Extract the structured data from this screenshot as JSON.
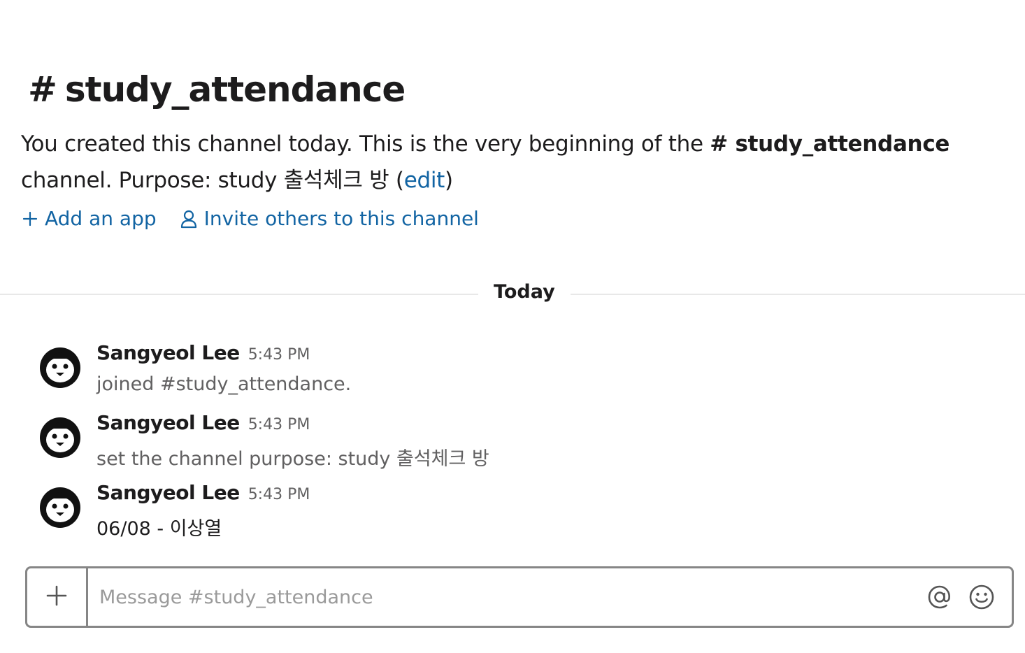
{
  "channel": {
    "hash": "#",
    "name": "study_attendance"
  },
  "intro": {
    "text_before": "You created this channel today. This is the very beginning of the ",
    "channel_ref": "# study_attendance",
    "text_after": " channel. Purpose: study 출석체크 방 (",
    "edit_link": "edit",
    "close_paren": ")"
  },
  "actions": {
    "add_app": "Add an app",
    "invite": "Invite others to this channel"
  },
  "divider": {
    "label": "Today"
  },
  "messages": [
    {
      "sender": "Sangyeol Lee",
      "time": "5:43 PM",
      "text": "joined #study_attendance.",
      "system": true,
      "avatar": "penguin-icon"
    },
    {
      "sender": "Sangyeol Lee",
      "time": "5:43 PM",
      "text": "set the channel purpose: study 출석체크 방",
      "system": true,
      "avatar": "penguin-icon"
    },
    {
      "sender": "Sangyeol Lee",
      "time": "5:43 PM",
      "text": "06/08 - 이상열",
      "system": false,
      "avatar": "penguin-icon"
    }
  ],
  "composer": {
    "placeholder": "Message #study_attendance",
    "plus_icon": "plus-icon",
    "mention_icon": "at-icon",
    "emoji_icon": "smiley-icon"
  },
  "colors": {
    "link": "#1264a3",
    "text": "#1d1c1d",
    "muted": "#616061",
    "border": "#868686"
  }
}
